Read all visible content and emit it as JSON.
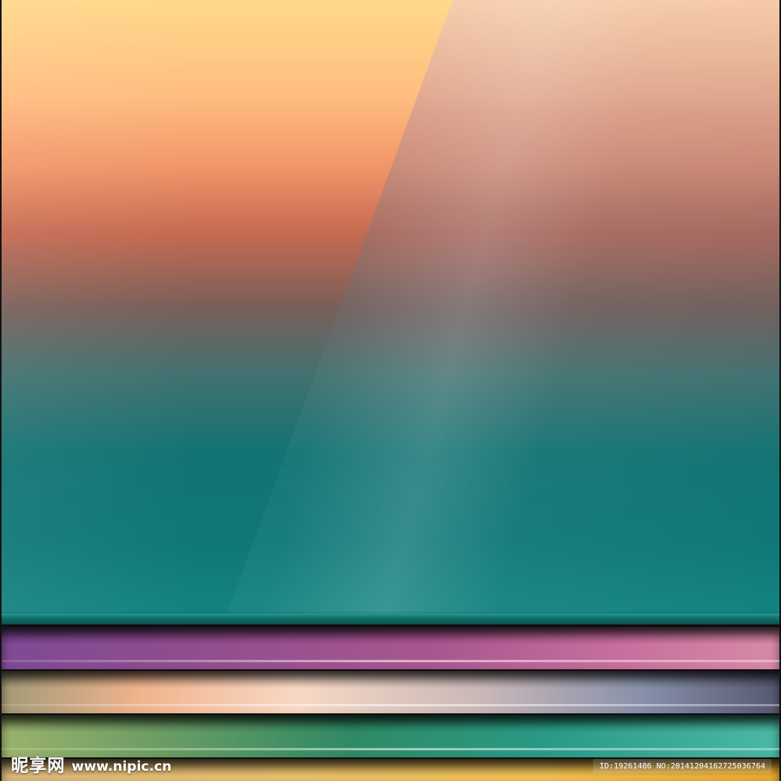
{
  "watermark": {
    "logo_text": "昵享网",
    "site_text": "www.nipic.cn",
    "id_text": "ID:19261486 NO:20141204162725036764"
  },
  "palette": {
    "top": "#ffd98b",
    "middle": "#c56a52",
    "teal": "#0f7777",
    "stripe_purple": "#8d4c8f",
    "stripe_peach": "#f7d8c4",
    "stripe_green": "#2f8a65",
    "stripe_gold": "#efbe52"
  }
}
